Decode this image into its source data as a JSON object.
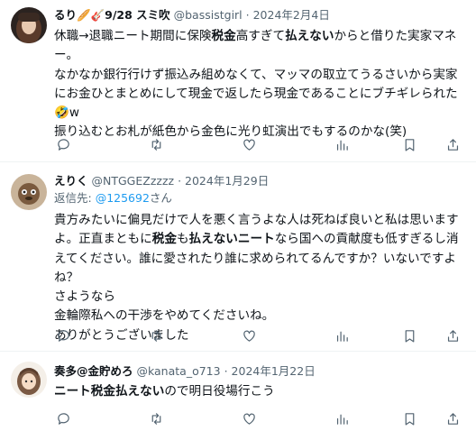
{
  "tweets": [
    {
      "name": "るり🥖🎸9/28 スミ吹",
      "handle": "@bassistgirl",
      "date": "2024年2月4日",
      "lines": [
        [
          [
            "休職→退職ニート期間に保険",
            false
          ],
          [
            "税金",
            true
          ],
          [
            "高すぎて",
            false
          ],
          [
            "払えない",
            true
          ],
          [
            "からと借りた実家マネー。",
            false
          ]
        ],
        [
          [
            "なかなか銀行行けず振込み組めなくて、マッマの取立てうるさいから実家にお金ひとまとめにして現金で返したら現金であることにブチギレられた🤣w",
            false
          ]
        ],
        [
          [
            "振り込むとお札が紙色から金色に光り虹演出でもするのかな(笑)",
            false
          ]
        ]
      ]
    },
    {
      "name": "えりく",
      "handle": "@NTGGEZzzzz",
      "date": "2024年1月29日",
      "reply_label": "返信先: ",
      "reply_handle": "@125692",
      "reply_suffix": "さん",
      "lines": [
        [
          [
            "貴方みたいに偏見だけで人を悪く言うよな人は死ねば良いと私は思いますよ。正直まともに",
            false
          ],
          [
            "税金",
            true
          ],
          [
            "も",
            false
          ],
          [
            "払えないニート",
            true
          ],
          [
            "なら国への貢献度も低すぎるし消えてください。誰に愛されたり誰に求められてるんですか？いないですよね？",
            false
          ]
        ],
        [
          [
            "さようなら",
            false
          ]
        ],
        [
          [
            "金輪際私への干渉をやめてくださいね。",
            false
          ]
        ],
        [
          [
            "ありがとうございました",
            false
          ]
        ]
      ]
    },
    {
      "name": "奏多@金貯めろ",
      "handle": "@kanata_o713",
      "date": "2024年1月22日",
      "lines": [
        [
          [
            "ニート税金払えない",
            true
          ],
          [
            "ので明日役場行こう",
            false
          ]
        ]
      ]
    }
  ],
  "separator": "·",
  "icons": [
    "reply-icon",
    "retweet-icon",
    "like-icon",
    "views-icon",
    "bookmark-icon",
    "share-icon"
  ]
}
